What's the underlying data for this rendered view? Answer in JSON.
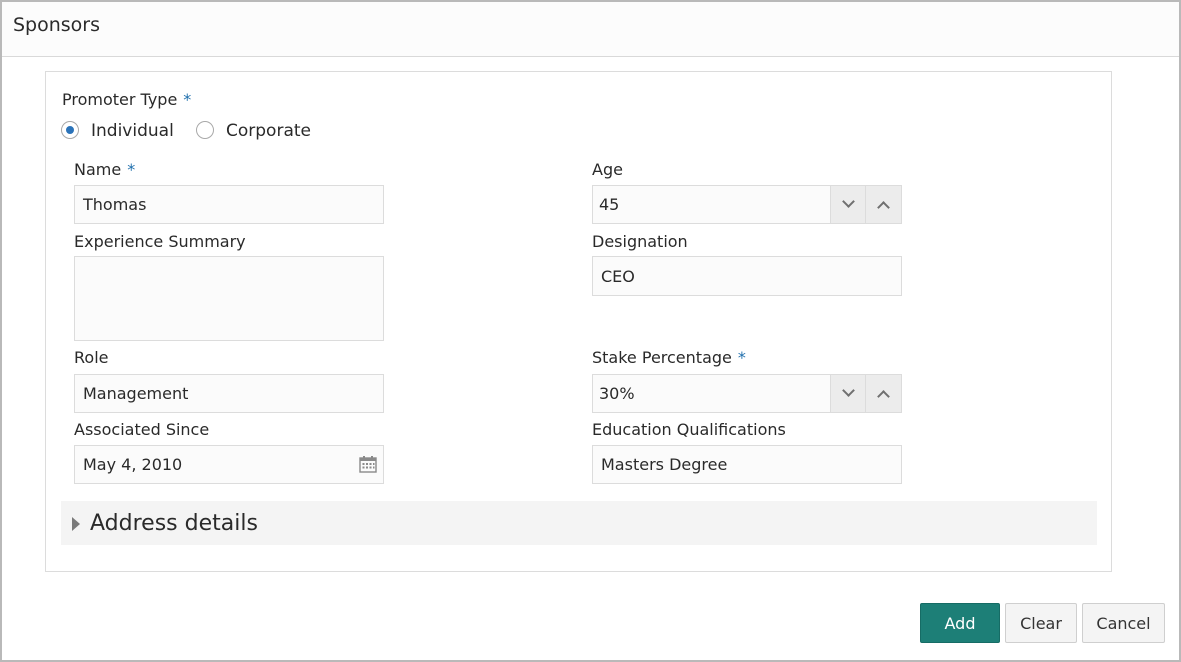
{
  "header": {
    "title": "Sponsors"
  },
  "promoter_type": {
    "label": "Promoter Type",
    "required_mark": "*",
    "options": [
      {
        "label": "Individual",
        "selected": true
      },
      {
        "label": "Corporate",
        "selected": false
      }
    ]
  },
  "fields": {
    "name": {
      "label": "Name",
      "required_mark": "*",
      "value": "Thomas"
    },
    "age": {
      "label": "Age",
      "value": "45"
    },
    "experience_summary": {
      "label": "Experience Summary",
      "value": ""
    },
    "designation": {
      "label": "Designation",
      "value": "CEO"
    },
    "role": {
      "label": "Role",
      "value": "Management"
    },
    "stake_percentage": {
      "label": "Stake Percentage",
      "required_mark": "*",
      "value": "30%"
    },
    "associated_since": {
      "label": "Associated Since",
      "value": "May 4, 2010"
    },
    "education_qualifications": {
      "label": "Education Qualifications",
      "value": "Masters Degree"
    }
  },
  "address_section": {
    "label": "Address details",
    "expanded": false
  },
  "actions": {
    "add": "Add",
    "clear": "Clear",
    "cancel": "Cancel"
  },
  "colors": {
    "primary": "#1d7f77",
    "radio_selected": "#2b73b9",
    "required": "#1f6fad"
  }
}
